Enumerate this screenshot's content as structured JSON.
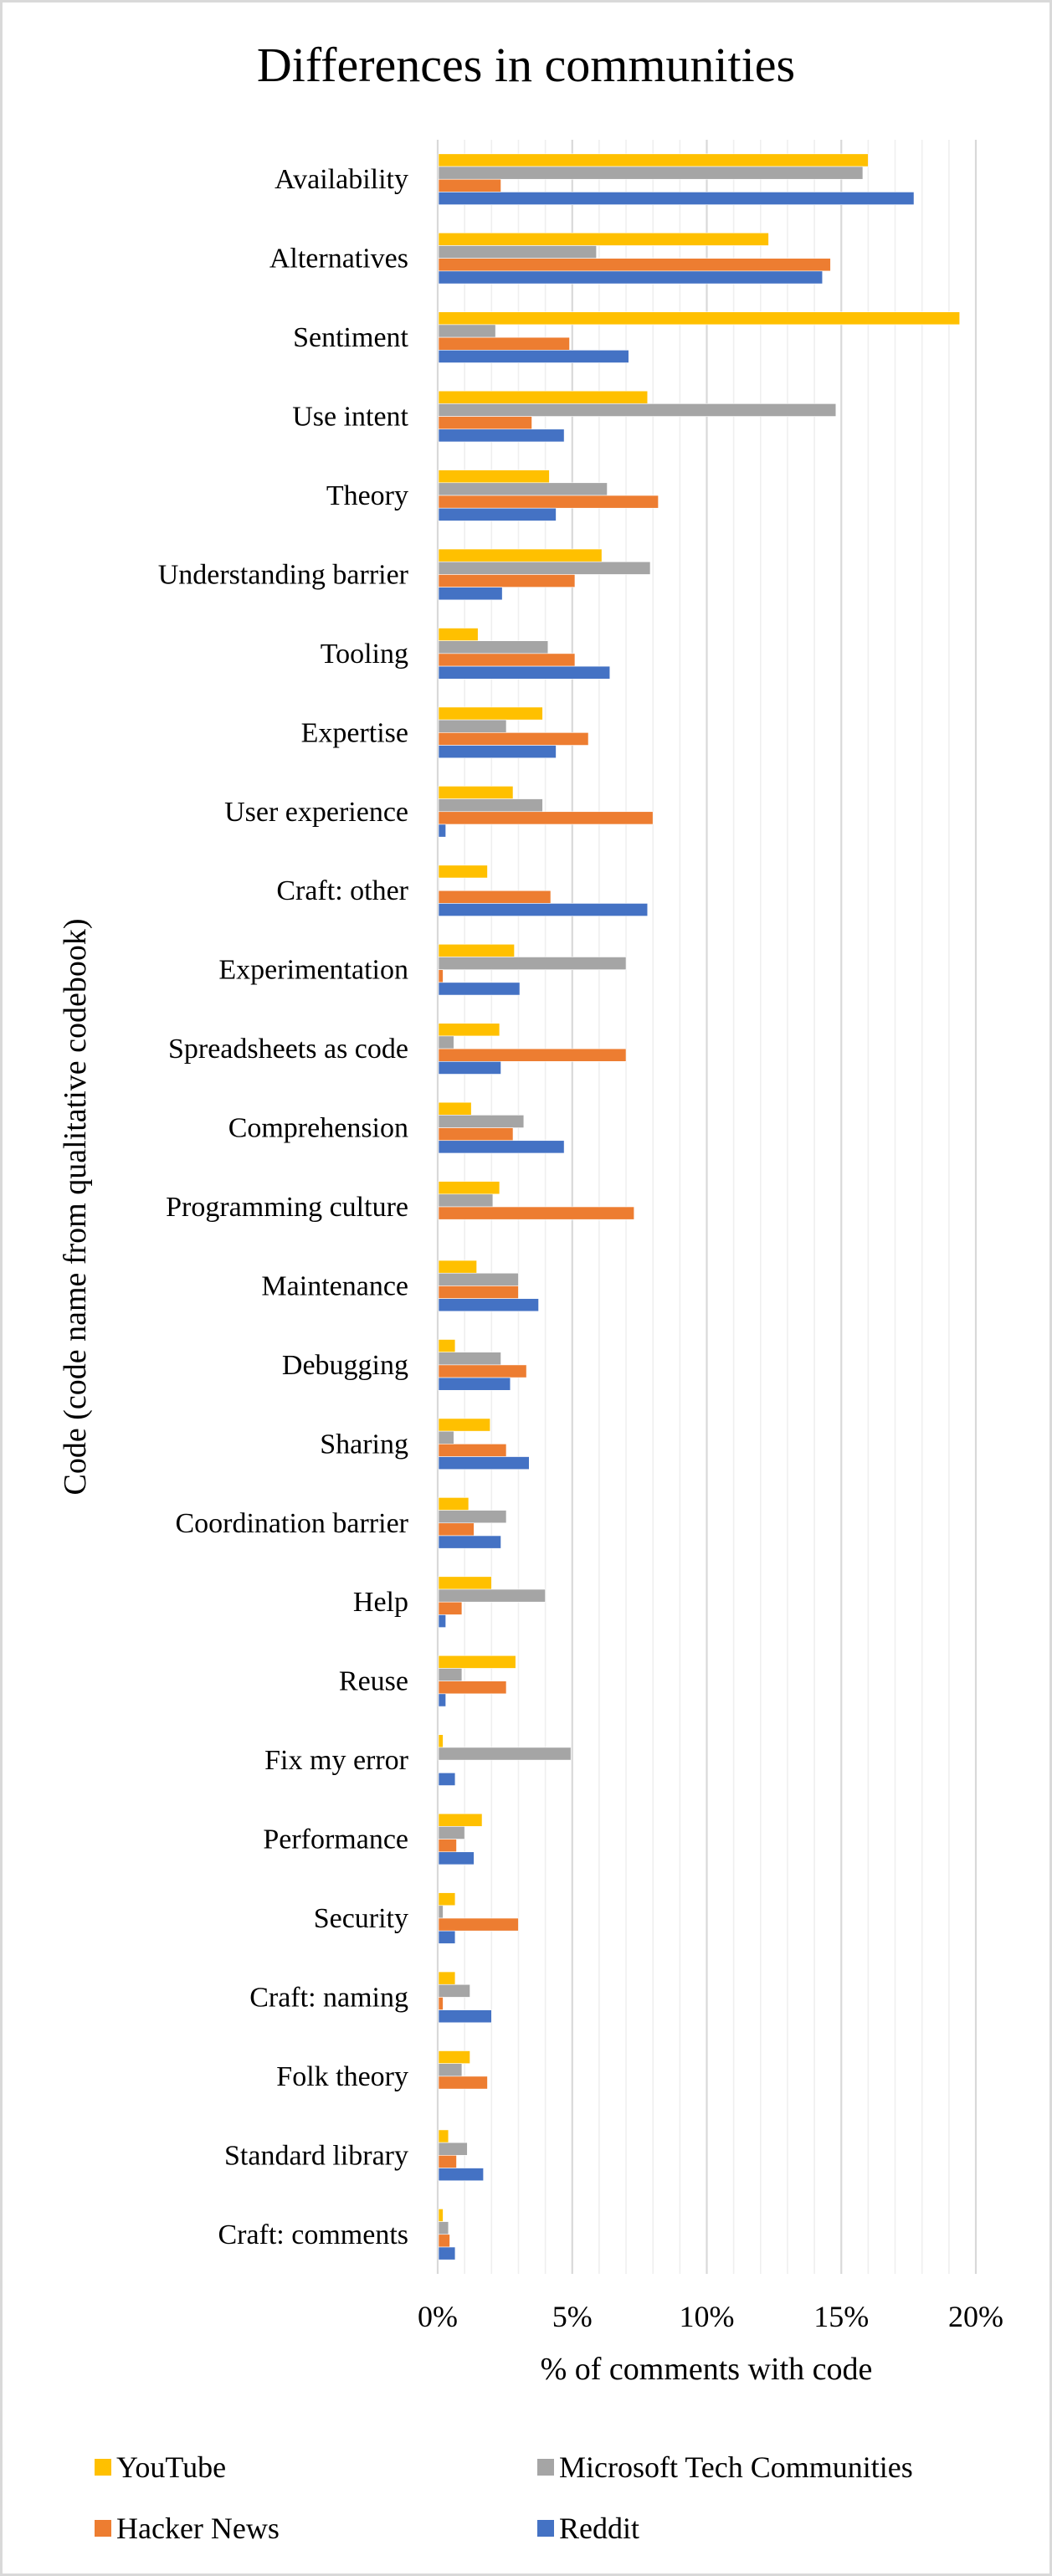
{
  "chart_data": {
    "type": "bar",
    "orientation": "horizontal",
    "title": "Differences in communities",
    "xlabel": "% of comments with code",
    "ylabel": "Code (code name from qualitative codebook)",
    "xlim": [
      0,
      20
    ],
    "x_ticks": [
      "0%",
      "5%",
      "10%",
      "15%",
      "20%"
    ],
    "x_tick_values": [
      0,
      5,
      10,
      15,
      20
    ],
    "minor_gridline_step": 1,
    "grid": true,
    "legend_position": "bottom",
    "categories": [
      "Availability",
      "Alternatives",
      "Sentiment",
      "Use intent",
      "Theory",
      "Understanding barrier",
      "Tooling",
      "Expertise",
      "User experience",
      "Craft: other",
      "Experimentation",
      "Spreadsheets as code",
      "Comprehension",
      "Programming culture",
      "Maintenance",
      "Debugging",
      "Sharing",
      "Coordination barrier",
      "Help",
      "Reuse",
      "Fix my error",
      "Performance",
      "Security",
      "Craft: naming",
      "Folk theory",
      "Standard library",
      "Craft: comments"
    ],
    "series": [
      {
        "name": "YouTube",
        "color": "#FFC000",
        "values": [
          16.0,
          12.3,
          19.4,
          7.8,
          4.15,
          6.1,
          1.5,
          3.9,
          2.8,
          1.85,
          2.85,
          2.3,
          1.25,
          2.3,
          1.45,
          0.65,
          1.95,
          1.15,
          2.0,
          2.9,
          0.2,
          1.65,
          0.65,
          0.65,
          1.2,
          0.4,
          0.2
        ]
      },
      {
        "name": "Microsoft Tech Communities",
        "color": "#A5A5A5",
        "values": [
          15.8,
          5.9,
          2.15,
          14.8,
          6.3,
          7.9,
          4.1,
          2.55,
          3.9,
          0.05,
          7.0,
          0.6,
          3.2,
          2.05,
          3.0,
          2.35,
          0.6,
          2.55,
          4.0,
          0.9,
          4.95,
          1.0,
          0.2,
          1.2,
          0.9,
          1.1,
          0.4
        ]
      },
      {
        "name": "Hacker News",
        "color": "#ED7D31",
        "values": [
          2.35,
          14.6,
          4.9,
          3.5,
          8.2,
          5.1,
          5.1,
          5.6,
          8.0,
          4.2,
          0.2,
          7.0,
          2.8,
          7.3,
          3.0,
          3.3,
          2.55,
          1.35,
          0.9,
          2.55,
          0,
          0.7,
          3.0,
          0.2,
          1.85,
          0.7,
          0.45
        ]
      },
      {
        "name": "Reddit",
        "color": "#4472C4",
        "values": [
          17.7,
          14.3,
          7.1,
          4.7,
          4.4,
          2.4,
          6.4,
          4.4,
          0.3,
          7.8,
          3.05,
          2.35,
          4.7,
          0,
          3.75,
          2.7,
          3.4,
          2.35,
          0.3,
          0.3,
          0.65,
          1.35,
          0.65,
          2.0,
          0,
          1.7,
          0.65
        ]
      }
    ]
  },
  "legend": {
    "items": [
      {
        "label": "YouTube",
        "color": "#FFC000"
      },
      {
        "label": "Microsoft Tech Communities",
        "color": "#A5A5A5"
      },
      {
        "label": "Hacker News",
        "color": "#ED7D31"
      },
      {
        "label": "Reddit",
        "color": "#4472C4"
      }
    ]
  }
}
